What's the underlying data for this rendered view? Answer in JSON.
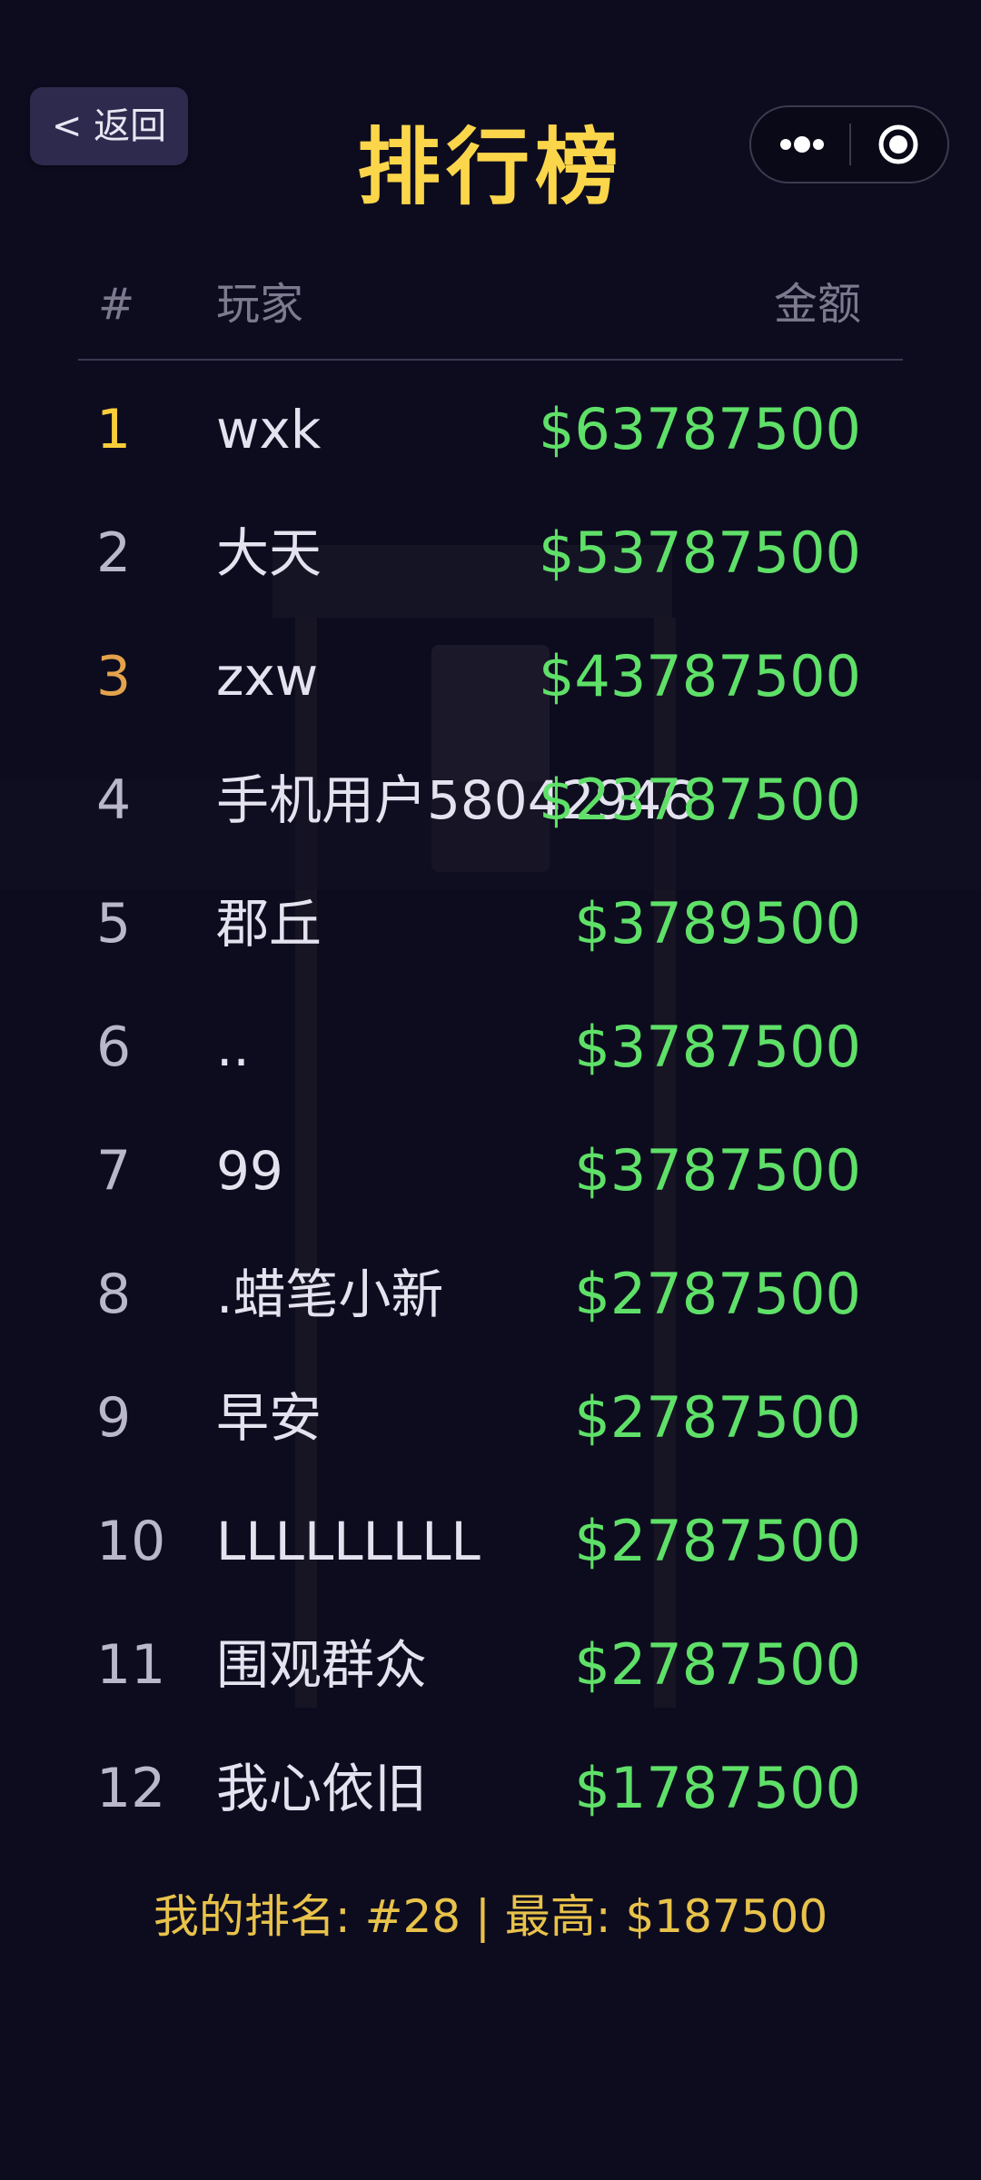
{
  "nav": {
    "back_label": "< 返回",
    "more_icon": "more-dots-icon",
    "close_icon": "target-circle-icon"
  },
  "page_title": "排行榜",
  "table": {
    "headers": {
      "rank": "#",
      "player": "玩家",
      "amount": "金额"
    },
    "rows": [
      {
        "rank": "1",
        "player": "wxk",
        "amount": "$63787500",
        "rank_color": "#f8cd3a"
      },
      {
        "rank": "2",
        "player": "大天",
        "amount": "$53787500"
      },
      {
        "rank": "3",
        "player": "zxw",
        "amount": "$43787500",
        "rank_color": "#e3a24c"
      },
      {
        "rank": "4",
        "player": "手机用户58042946",
        "amount": "$23787500"
      },
      {
        "rank": "5",
        "player": "郡丘",
        "amount": "$3789500"
      },
      {
        "rank": "6",
        "player": "..",
        "amount": "$3787500"
      },
      {
        "rank": "7",
        "player": "99",
        "amount": "$3787500"
      },
      {
        "rank": "8",
        "player": ".蜡笔小新",
        "amount": "$2787500"
      },
      {
        "rank": "9",
        "player": "早安",
        "amount": "$2787500"
      },
      {
        "rank": "10",
        "player": "LLLLLLLLL",
        "amount": "$2787500"
      },
      {
        "rank": "11",
        "player": "围观群众",
        "amount": "$2787500"
      },
      {
        "rank": "12",
        "player": "我心依旧",
        "amount": "$1787500"
      }
    ]
  },
  "footer": {
    "text": "我的排名: #28  |  最高: $187500"
  },
  "colors": {
    "title": "#fcd64a",
    "amount": "#5fe068",
    "footer": "#e8c24a",
    "background": "#0d0c1f"
  }
}
